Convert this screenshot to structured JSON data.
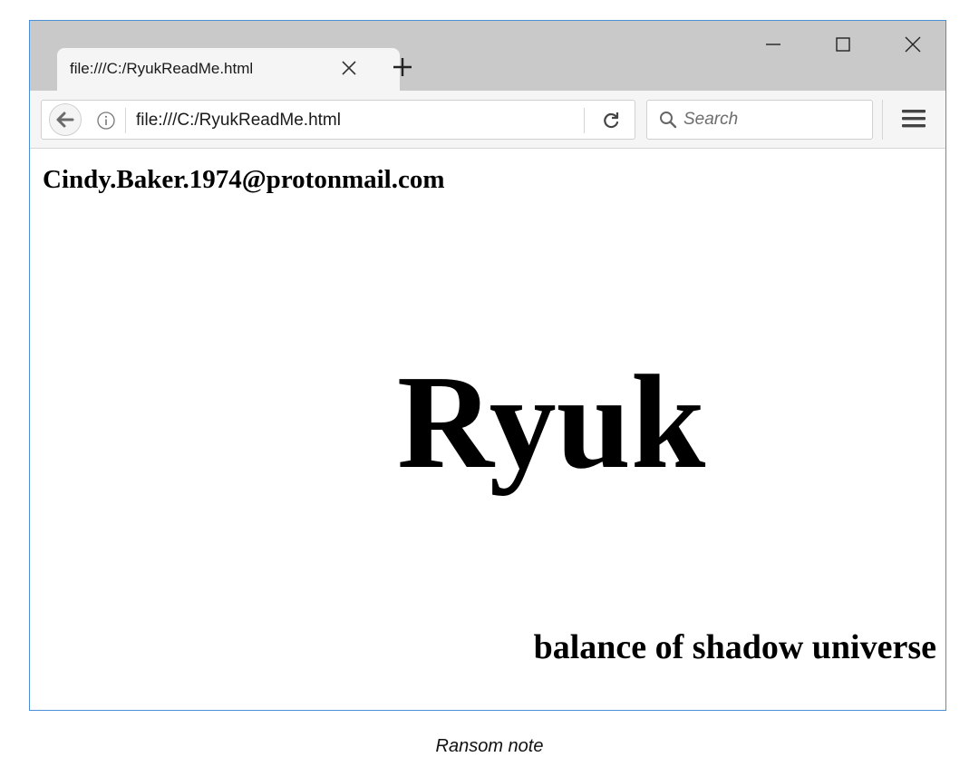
{
  "browser": {
    "tab": {
      "title": "file:///C:/RyukReadMe.html"
    },
    "address_bar": {
      "url": "file:///C:/RyukReadMe.html"
    },
    "search": {
      "placeholder": "Search"
    },
    "icons": {
      "tab_close": "close-icon",
      "new_tab": "plus-icon",
      "minimize": "minimize-icon",
      "maximize": "maximize-icon",
      "close": "close-icon",
      "back": "back-arrow-icon",
      "info": "info-icon",
      "reload": "reload-icon",
      "search": "search-icon",
      "menu": "hamburger-menu-icon"
    }
  },
  "page": {
    "email": "Cindy.Baker.1974@protonmail.com",
    "heading": "Ryuk",
    "tagline": "balance of shadow universe"
  },
  "caption": "Ransom note",
  "colors": {
    "titlebar": "#c9c9c9",
    "window_border": "#4a90d9",
    "toolbar": "#f5f5f5"
  }
}
